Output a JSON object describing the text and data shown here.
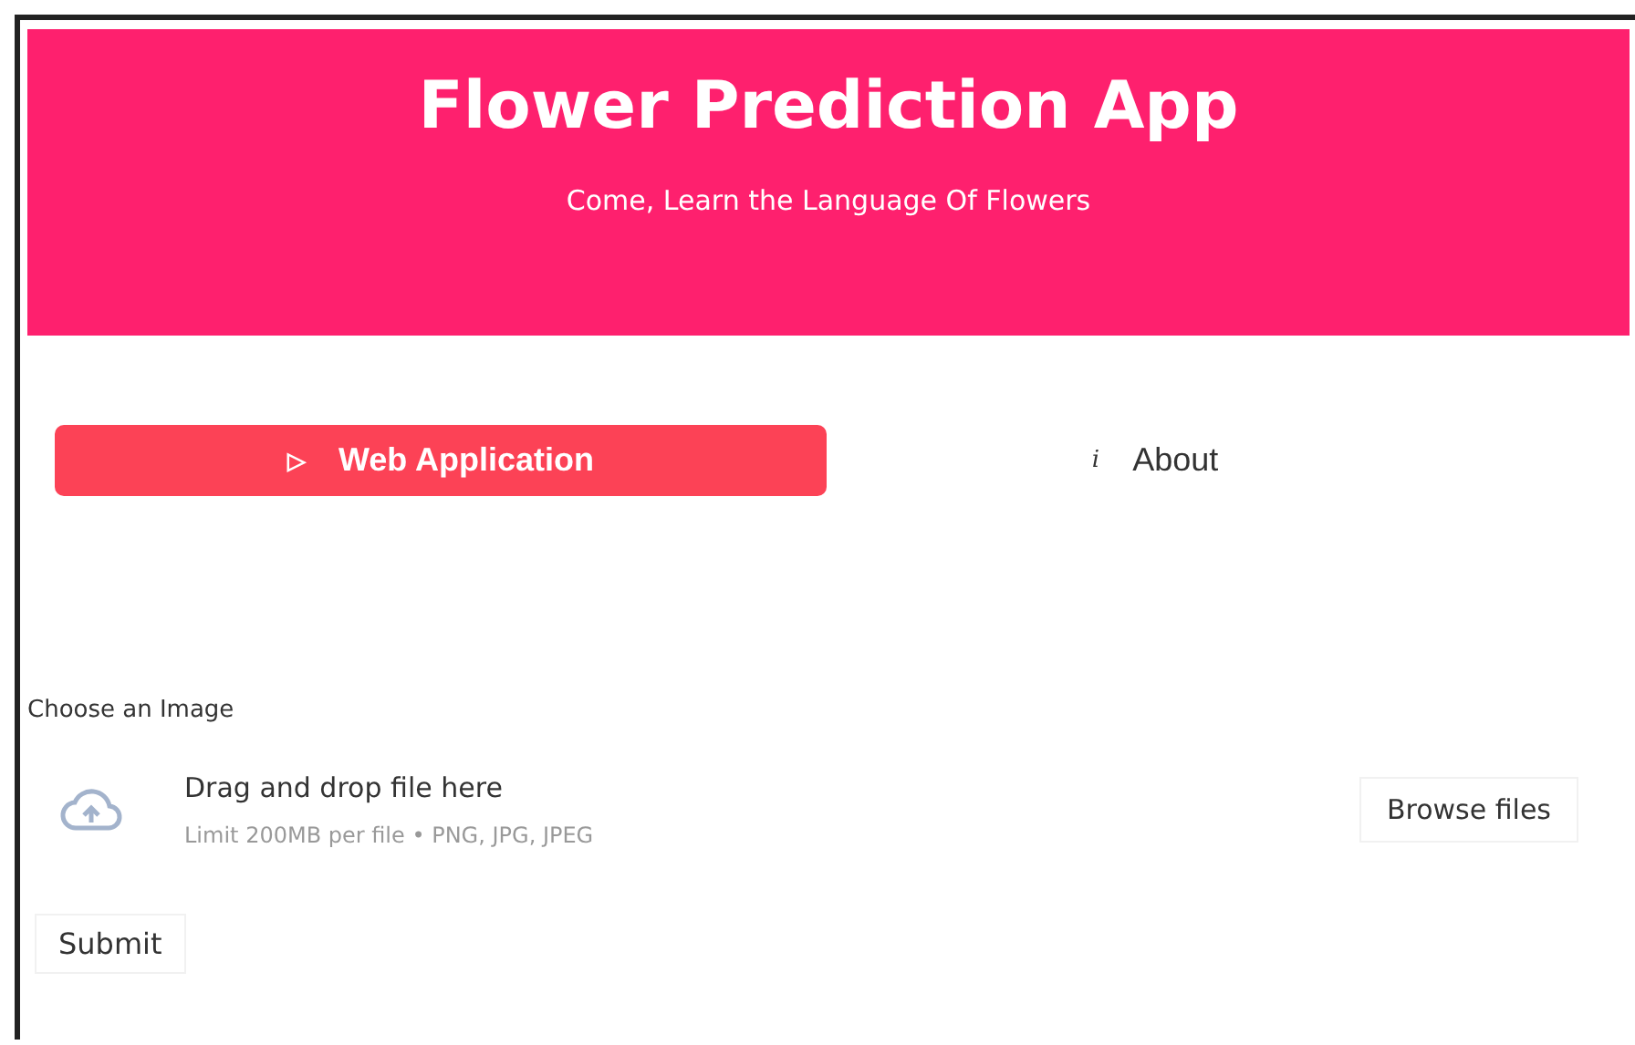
{
  "header": {
    "title": "Flower Prediction App",
    "subtitle": "Come, Learn the Language Of Flowers"
  },
  "tabs": [
    {
      "icon": "▷",
      "label": "Web Application",
      "selected": true
    },
    {
      "icon": "i",
      "label": "About",
      "selected": false
    }
  ],
  "uploader": {
    "label": "Choose an Image",
    "prompt": "Drag and drop file here",
    "hint": "Limit 200MB per file • PNG, JPG, JPEG",
    "button": "Browse files"
  },
  "submit": "Submit"
}
